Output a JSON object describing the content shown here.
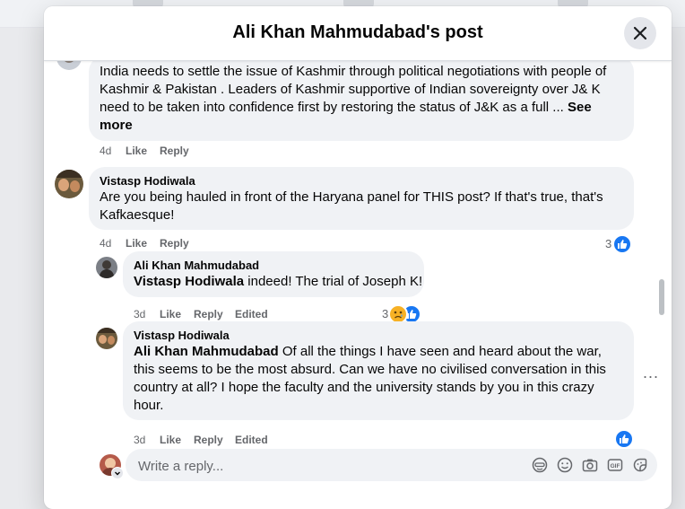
{
  "modal": {
    "title": "Ali Khan Mahmudabad's post"
  },
  "comments": [
    {
      "text": "India needs to settle the issue of Kashmir through political negotiations with people of Kashmir & Pakistan . Leaders of Kashmir supportive of Indian sovereignty over J& K need to be taken into confidence first by restoring the status of J&K as a full ...",
      "see_more": "See more",
      "time": "4d",
      "like": "Like",
      "reply": "Reply"
    },
    {
      "author": "Vistasp Hodiwala",
      "text": "Are you being hauled in front of the Haryana panel for THIS post? If that's true, that's Kafkaesque!",
      "time": "4d",
      "like": "Like",
      "reply": "Reply",
      "reaction_count": "3"
    },
    {
      "author": "Ali Khan Mahmudabad",
      "mention": "Vistasp Hodiwala",
      "text": " indeed! The trial of Joseph K!",
      "time": "3d",
      "like": "Like",
      "reply": "Reply",
      "edited": "Edited",
      "reaction_count": "3"
    },
    {
      "author": "Vistasp Hodiwala",
      "mention": "Ali Khan Mahmudabad",
      "text": " Of all the things I have seen and heard about the war, this seems to be the most absurd. Can we have no civilised conversation in this country at all? I hope the faculty and the university stands by you in this crazy hour.",
      "time": "3d",
      "like": "Like",
      "reply": "Reply",
      "edited": "Edited"
    }
  ],
  "reply_box": {
    "placeholder": "Write a reply..."
  },
  "icons": {
    "close": "close-icon",
    "like": "thumbs-up-icon",
    "sad": "sad-face-icon",
    "avatar_emoji": "avatar-icon",
    "emoji": "smiley-icon",
    "camera": "camera-icon",
    "gif": "gif-icon",
    "sticker": "sticker-icon",
    "more": "more-dots-icon"
  },
  "colors": {
    "accent": "#1877f2",
    "bubble": "#f0f2f5",
    "secondary_text": "#65676b"
  }
}
